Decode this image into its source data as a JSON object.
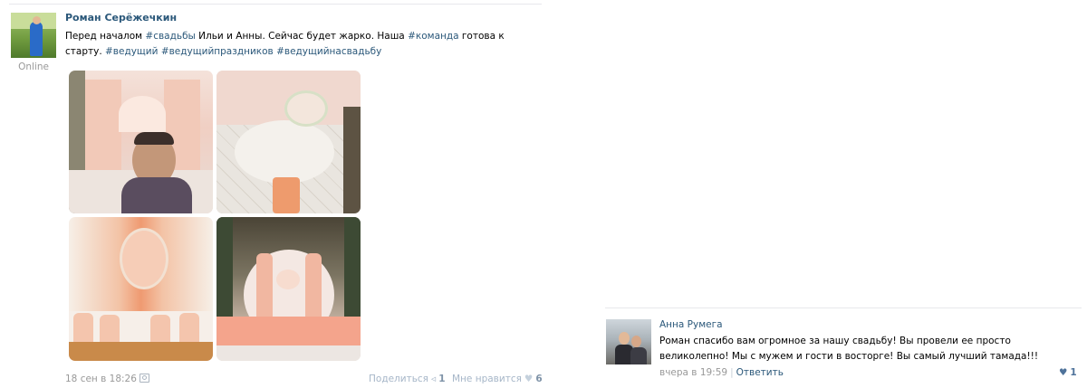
{
  "post": {
    "author": "Роман Серёжечкин",
    "status": "Online",
    "text_segments": [
      {
        "text": "Перед началом ",
        "tag": false
      },
      {
        "text": "#свадьбы",
        "tag": true
      },
      {
        "text": " Ильи и Анны. Сейчас будет жарко. Наша ",
        "tag": false
      },
      {
        "text": "#команда",
        "tag": true
      },
      {
        "text": " готова к старту. ",
        "tag": false
      },
      {
        "text": "#ведущий",
        "tag": true
      },
      {
        "text": " ",
        "tag": false
      },
      {
        "text": "#ведущийпраздников",
        "tag": true
      },
      {
        "text": " ",
        "tag": false
      },
      {
        "text": "#ведущийнасвадьбу",
        "tag": true
      }
    ],
    "date": "18 сен в 18:26",
    "share_label": "Поделиться",
    "share_count": "1",
    "like_label": "Мне нравится",
    "like_count": "6",
    "photos": [
      {
        "name": "wedding-hall-host-photo",
        "icon": "photo"
      },
      {
        "name": "wedding-table-flowers-photo",
        "icon": "photo"
      },
      {
        "name": "wedding-backdrop-photo",
        "icon": "photo"
      },
      {
        "name": "wedding-arch-photo",
        "icon": "photo"
      }
    ],
    "colors": {
      "link": "#2b587a",
      "muted": "#999999",
      "action": "#a6b6c8"
    }
  },
  "comment": {
    "author": "Анна Румега",
    "text": "Роман спасибо вам огромное за нашу свадьбу! Вы провели ее просто великолепно! Мы с мужем и гости в восторге! Вы самый лучший тамада!!!",
    "date": "вчера в 19:59",
    "reply_label": "Ответить",
    "like_count": "1"
  }
}
